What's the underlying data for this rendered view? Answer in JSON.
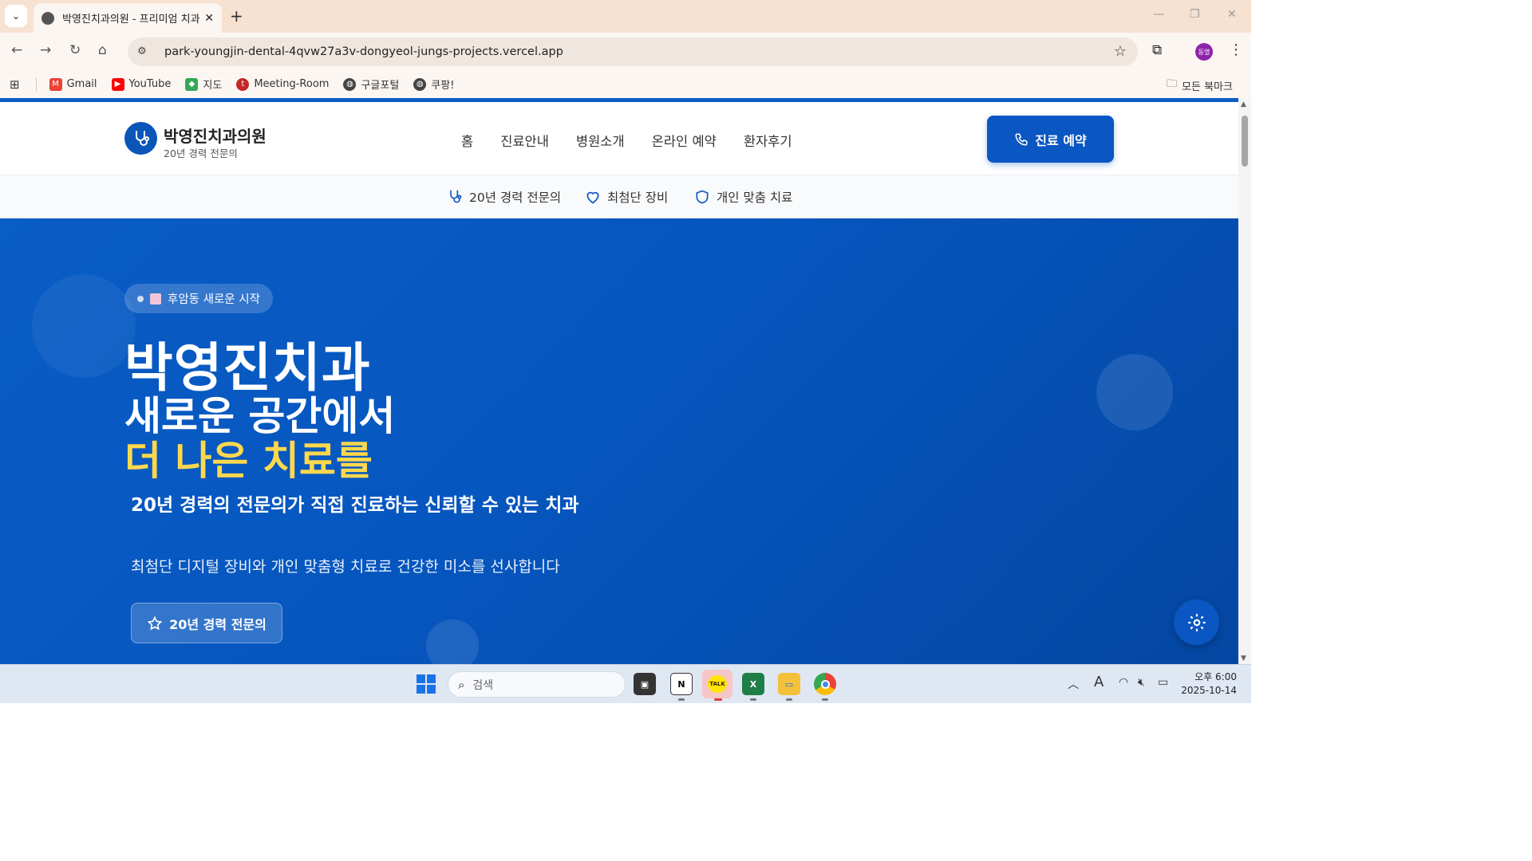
{
  "browser": {
    "tab_title": "박영진치과의원 - 프리미엄 치과",
    "url": "park-youngjin-dental-4qvw27a3v-dongyeol-jungs-projects.vercel.app",
    "profile_initials": "동열",
    "bookmarks": [
      "Gmail",
      "YouTube",
      "지도",
      "Meeting-Room",
      "구글포털",
      "쿠팡!"
    ],
    "all_bookmarks": "모든 북마크"
  },
  "site": {
    "brand": "박영진치과의원",
    "brand_sub": "20년 경력 전문의",
    "nav": [
      "홈",
      "진료안내",
      "병원소개",
      "온라인 예약",
      "환자후기"
    ],
    "cta": "진료 예약",
    "features": [
      "20년 경력 전문의",
      "최첨단 장비",
      "개인 맞춤 치료"
    ]
  },
  "hero": {
    "badge": "후암동 새로운 시작",
    "line1": "박영진치과",
    "line2": "새로운 공간에서",
    "line3": "더 나은 치료를",
    "lead": "20년 경력의 전문의가 직접 진료하는 신뢰할 수 있는 치과",
    "sub": "최첨단 디지털 장비와 개인 맞춤형 치료로 건강한 미소를 선사합니다",
    "button": "20년 경력 전문의"
  },
  "colors": {
    "primary": "#0a56c2",
    "accent_yellow": "#ffd84d",
    "tab_strip": "#f7e1d0"
  },
  "taskbar": {
    "search_placeholder": "검색",
    "time": "오후 6:00",
    "date": "2025-10-14"
  }
}
